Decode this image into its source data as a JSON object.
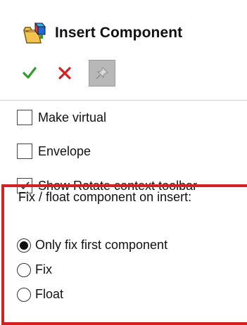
{
  "header": {
    "title": "Insert Component"
  },
  "actions": {
    "ok_icon": "checkmark-icon",
    "cancel_icon": "close-icon",
    "pin_icon": "pushpin-icon",
    "ok_color": "#2e9e2e",
    "cancel_color": "#d42020"
  },
  "options": [
    {
      "label": "Make virtual",
      "checked": false
    },
    {
      "label": "Envelope",
      "checked": false
    },
    {
      "label": "Show Rotate context toolbar",
      "checked": true
    }
  ],
  "fix_float": {
    "label": "Fix / float component on insert:",
    "choices": [
      {
        "label": "Only fix first component",
        "selected": true
      },
      {
        "label": "Fix",
        "selected": false
      },
      {
        "label": "Float",
        "selected": false
      }
    ]
  },
  "highlight_color": "#d42020"
}
